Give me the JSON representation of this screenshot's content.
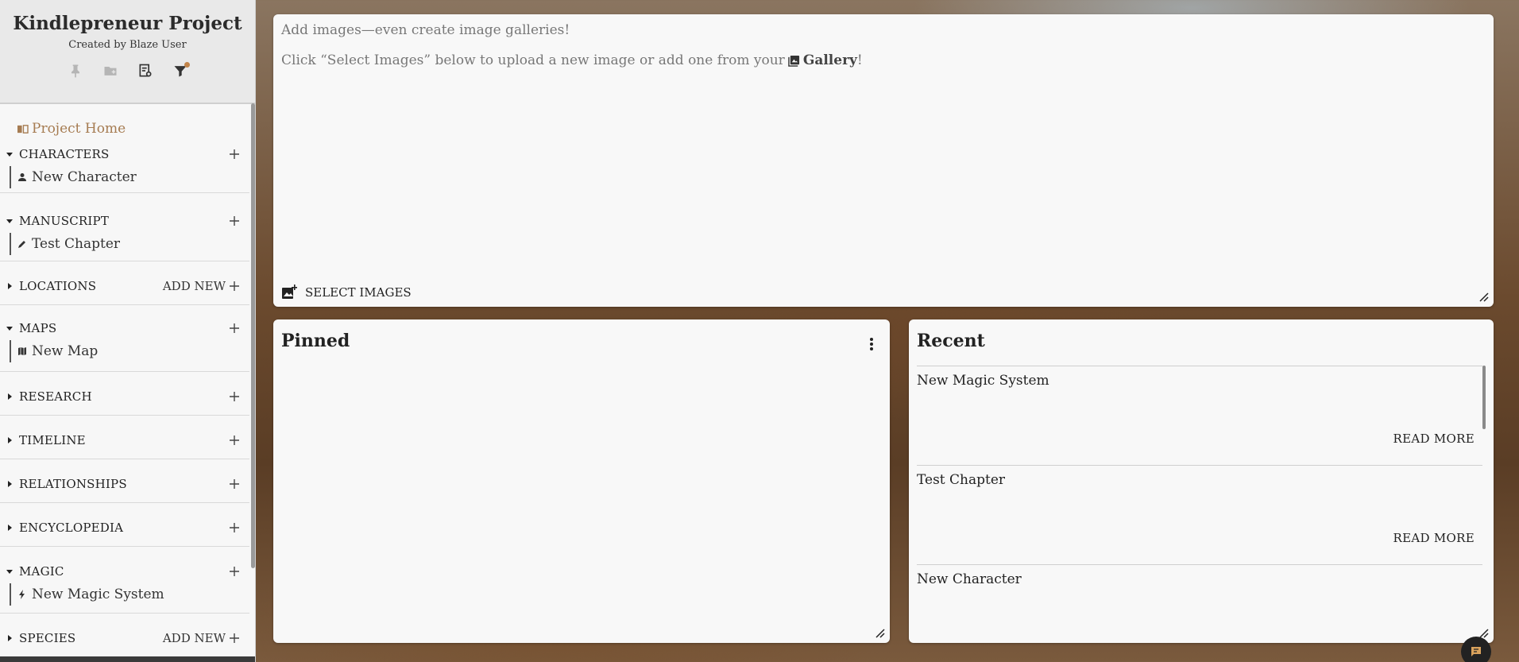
{
  "sidebar": {
    "project_title": "Kindlepreneur Project",
    "created_by": "Created by Blaze User",
    "header_icons": [
      "pin-icon",
      "folder-add-icon",
      "book-search-icon",
      "filter-icon"
    ],
    "project_home": "Project Home",
    "sections": [
      {
        "label": "CHARACTERS",
        "add_label": "",
        "items": [
          {
            "label": "New Character",
            "icon": "person-icon"
          }
        ]
      },
      {
        "label": "MANUSCRIPT",
        "add_label": "",
        "items": [
          {
            "label": "Test Chapter",
            "icon": "pencil-icon"
          }
        ]
      },
      {
        "label": "LOCATIONS",
        "add_label": "ADD NEW",
        "items": []
      },
      {
        "label": "MAPS",
        "add_label": "",
        "items": [
          {
            "label": "New Map",
            "icon": "map-icon"
          }
        ]
      },
      {
        "label": "RESEARCH",
        "add_label": "",
        "items": []
      },
      {
        "label": "TIMELINE",
        "add_label": "",
        "items": []
      },
      {
        "label": "RELATIONSHIPS",
        "add_label": "",
        "items": []
      },
      {
        "label": "ENCYCLOPEDIA",
        "add_label": "",
        "items": []
      },
      {
        "label": "MAGIC",
        "add_label": "",
        "items": [
          {
            "label": "New Magic System",
            "icon": "bolt-icon"
          }
        ]
      },
      {
        "label": "SPECIES",
        "add_label": "ADD NEW",
        "items": []
      }
    ]
  },
  "image_card": {
    "placeholder_line": "Add images—even create image galleries!",
    "instruction_prefix": "Click “Select Images” below to upload a new image or add one from your",
    "gallery_label": "Gallery",
    "instruction_suffix": "!",
    "select_button": "SELECT IMAGES"
  },
  "pinned": {
    "title": "Pinned"
  },
  "recent": {
    "title": "Recent",
    "items": [
      {
        "name": "New Magic System",
        "action": "READ MORE"
      },
      {
        "name": "Test Chapter",
        "action": "READ MORE"
      },
      {
        "name": "New Character",
        "action": ""
      }
    ]
  },
  "colors": {
    "accent": "#a67c52",
    "sidebar_bg": "#f7f7f7",
    "header_bg": "#e9e9e9",
    "card_bg": "#f8f8f8"
  }
}
